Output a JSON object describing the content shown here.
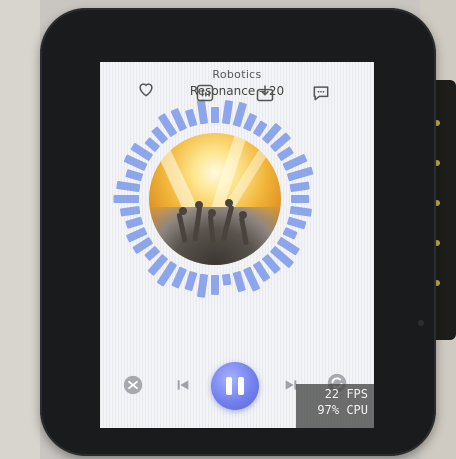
{
  "header": {
    "title": "Robotics",
    "subtitle": "Resonance – 20"
  },
  "player": {
    "state": "playing"
  },
  "perf": {
    "fps": "22 FPS",
    "cpu": "97% CPU"
  },
  "colors": {
    "accent": "#6f7cec",
    "viz_bar": "#7a98ea",
    "icon": "#5b5b5b"
  },
  "icons": [
    "heart-icon",
    "equalizer-icon",
    "download-icon",
    "chat-icon",
    "shuffle-icon",
    "previous-icon",
    "pause-icon",
    "next-icon",
    "repeat-icon"
  ]
}
